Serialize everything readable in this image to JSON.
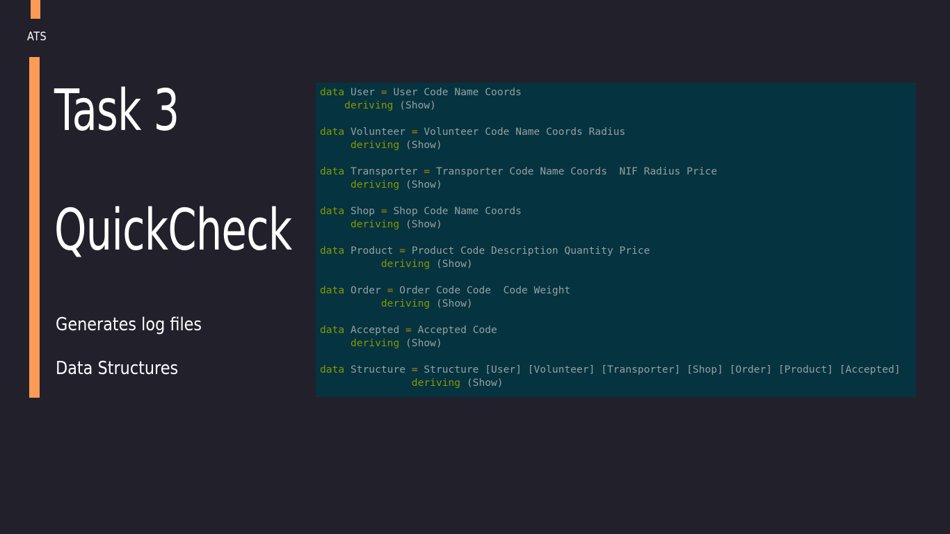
{
  "brand": "ATS",
  "title_lines": [
    "Task 3",
    "QuickCheck"
  ],
  "bullets": [
    "Generates log files",
    "Data Structures"
  ],
  "code": [
    {
      "indent": "",
      "kw": "data",
      "rest": " User ",
      "op": "=",
      "tail": " User Code Name Coords"
    },
    {
      "indent": "    ",
      "kw": "deriving",
      "rest": " (Show)",
      "op": "",
      "tail": ""
    },
    {
      "indent": "",
      "kw": "",
      "rest": "",
      "op": "",
      "tail": ""
    },
    {
      "indent": "",
      "kw": "data",
      "rest": " Volunteer ",
      "op": "=",
      "tail": " Volunteer Code Name Coords Radius"
    },
    {
      "indent": "     ",
      "kw": "deriving",
      "rest": " (Show)",
      "op": "",
      "tail": ""
    },
    {
      "indent": "",
      "kw": "",
      "rest": "",
      "op": "",
      "tail": ""
    },
    {
      "indent": "",
      "kw": "data",
      "rest": " Transporter ",
      "op": "=",
      "tail": " Transporter Code Name Coords  NIF Radius Price"
    },
    {
      "indent": "     ",
      "kw": "deriving",
      "rest": " (Show)",
      "op": "",
      "tail": ""
    },
    {
      "indent": "",
      "kw": "",
      "rest": "",
      "op": "",
      "tail": ""
    },
    {
      "indent": "",
      "kw": "data",
      "rest": " Shop ",
      "op": "=",
      "tail": " Shop Code Name Coords"
    },
    {
      "indent": "     ",
      "kw": "deriving",
      "rest": " (Show)",
      "op": "",
      "tail": ""
    },
    {
      "indent": "",
      "kw": "",
      "rest": "",
      "op": "",
      "tail": ""
    },
    {
      "indent": "",
      "kw": "data",
      "rest": " Product ",
      "op": "=",
      "tail": " Product Code Description Quantity Price"
    },
    {
      "indent": "          ",
      "kw": "deriving",
      "rest": " (Show)",
      "op": "",
      "tail": ""
    },
    {
      "indent": "",
      "kw": "",
      "rest": "",
      "op": "",
      "tail": ""
    },
    {
      "indent": "",
      "kw": "data",
      "rest": " Order ",
      "op": "=",
      "tail": " Order Code Code  Code Weight"
    },
    {
      "indent": "          ",
      "kw": "deriving",
      "rest": " (Show)",
      "op": "",
      "tail": ""
    },
    {
      "indent": "",
      "kw": "",
      "rest": "",
      "op": "",
      "tail": ""
    },
    {
      "indent": "",
      "kw": "data",
      "rest": " Accepted ",
      "op": "=",
      "tail": " Accepted Code"
    },
    {
      "indent": "     ",
      "kw": "deriving",
      "rest": " (Show)",
      "op": "",
      "tail": ""
    },
    {
      "indent": "",
      "kw": "",
      "rest": "",
      "op": "",
      "tail": ""
    },
    {
      "indent": "",
      "kw": "data",
      "rest": " Structure ",
      "op": "=",
      "tail": " Structure [User] [Volunteer] [Transporter] [Shop] [Order] [Product] [Accepted]"
    },
    {
      "indent": "               ",
      "kw": "deriving",
      "rest": " (Show)",
      "op": "",
      "tail": ""
    }
  ],
  "colors": {
    "background": "#21202b",
    "accent": "#fb9b56",
    "code_background": "#063340",
    "code_text": "#93a1a1",
    "keyword": "#859900",
    "operator": "#b58900"
  }
}
